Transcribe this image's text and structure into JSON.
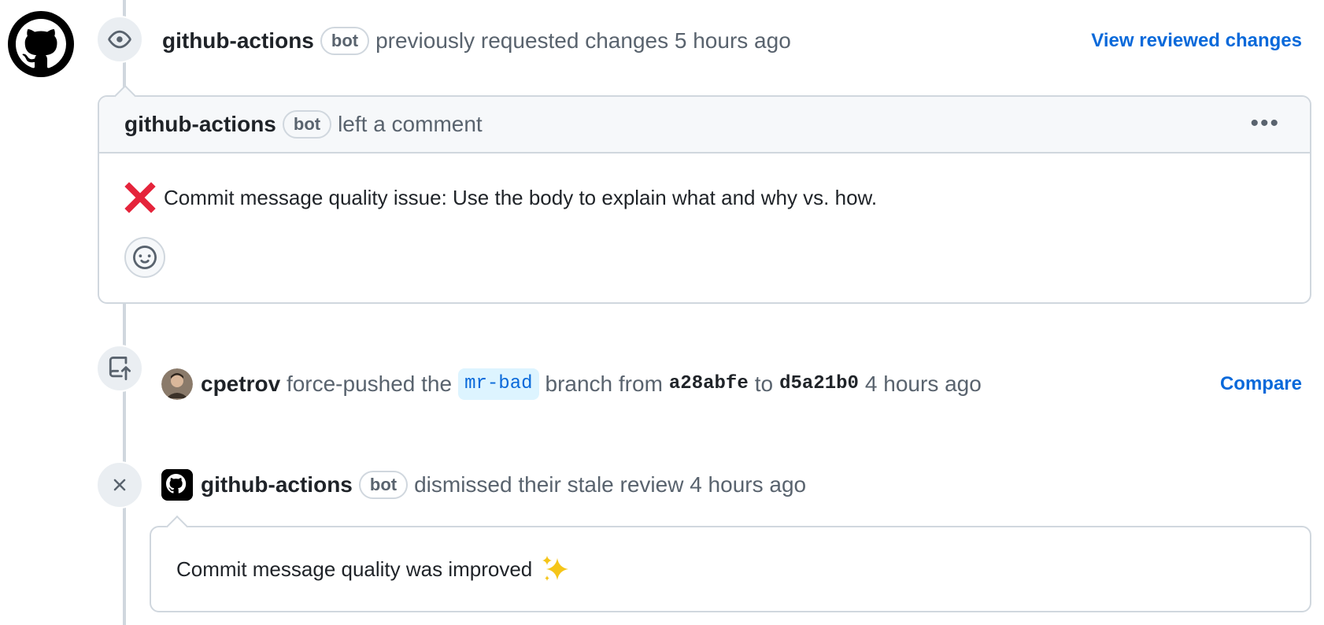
{
  "review_event": {
    "author": "github-actions",
    "bot_label": "bot",
    "action": "previously requested changes",
    "time": "5 hours ago",
    "link": "View reviewed changes"
  },
  "review_comment": {
    "author": "github-actions",
    "bot_label": "bot",
    "action": "left a comment",
    "body": "Commit message quality issue: Use the body to explain what and why vs. how.",
    "menu_icon": "kebab-horizontal-icon",
    "status_icon": "red-x-icon",
    "reaction_icon": "smiley-icon"
  },
  "force_push_event": {
    "author": "cpetrov",
    "action_prefix": "force-pushed the",
    "branch": "mr-bad",
    "action_mid": "branch from",
    "from_sha": "a28abfe",
    "to_word": "to",
    "to_sha": "d5a21b0",
    "time": "4 hours ago",
    "link": "Compare",
    "icon": "repo-push-icon"
  },
  "dismiss_event": {
    "author": "github-actions",
    "bot_label": "bot",
    "action": "dismissed their stale review",
    "time": "4 hours ago",
    "message": "Commit message quality was improved",
    "icon": "x-icon",
    "message_emoji": "sparkles-icon"
  },
  "colors": {
    "link": "#0969da",
    "muted": "#59636e",
    "border": "#d0d7de",
    "branch_bg": "#ddf4ff",
    "red_x": "#e5243b",
    "sparkle": "#f5c518"
  }
}
